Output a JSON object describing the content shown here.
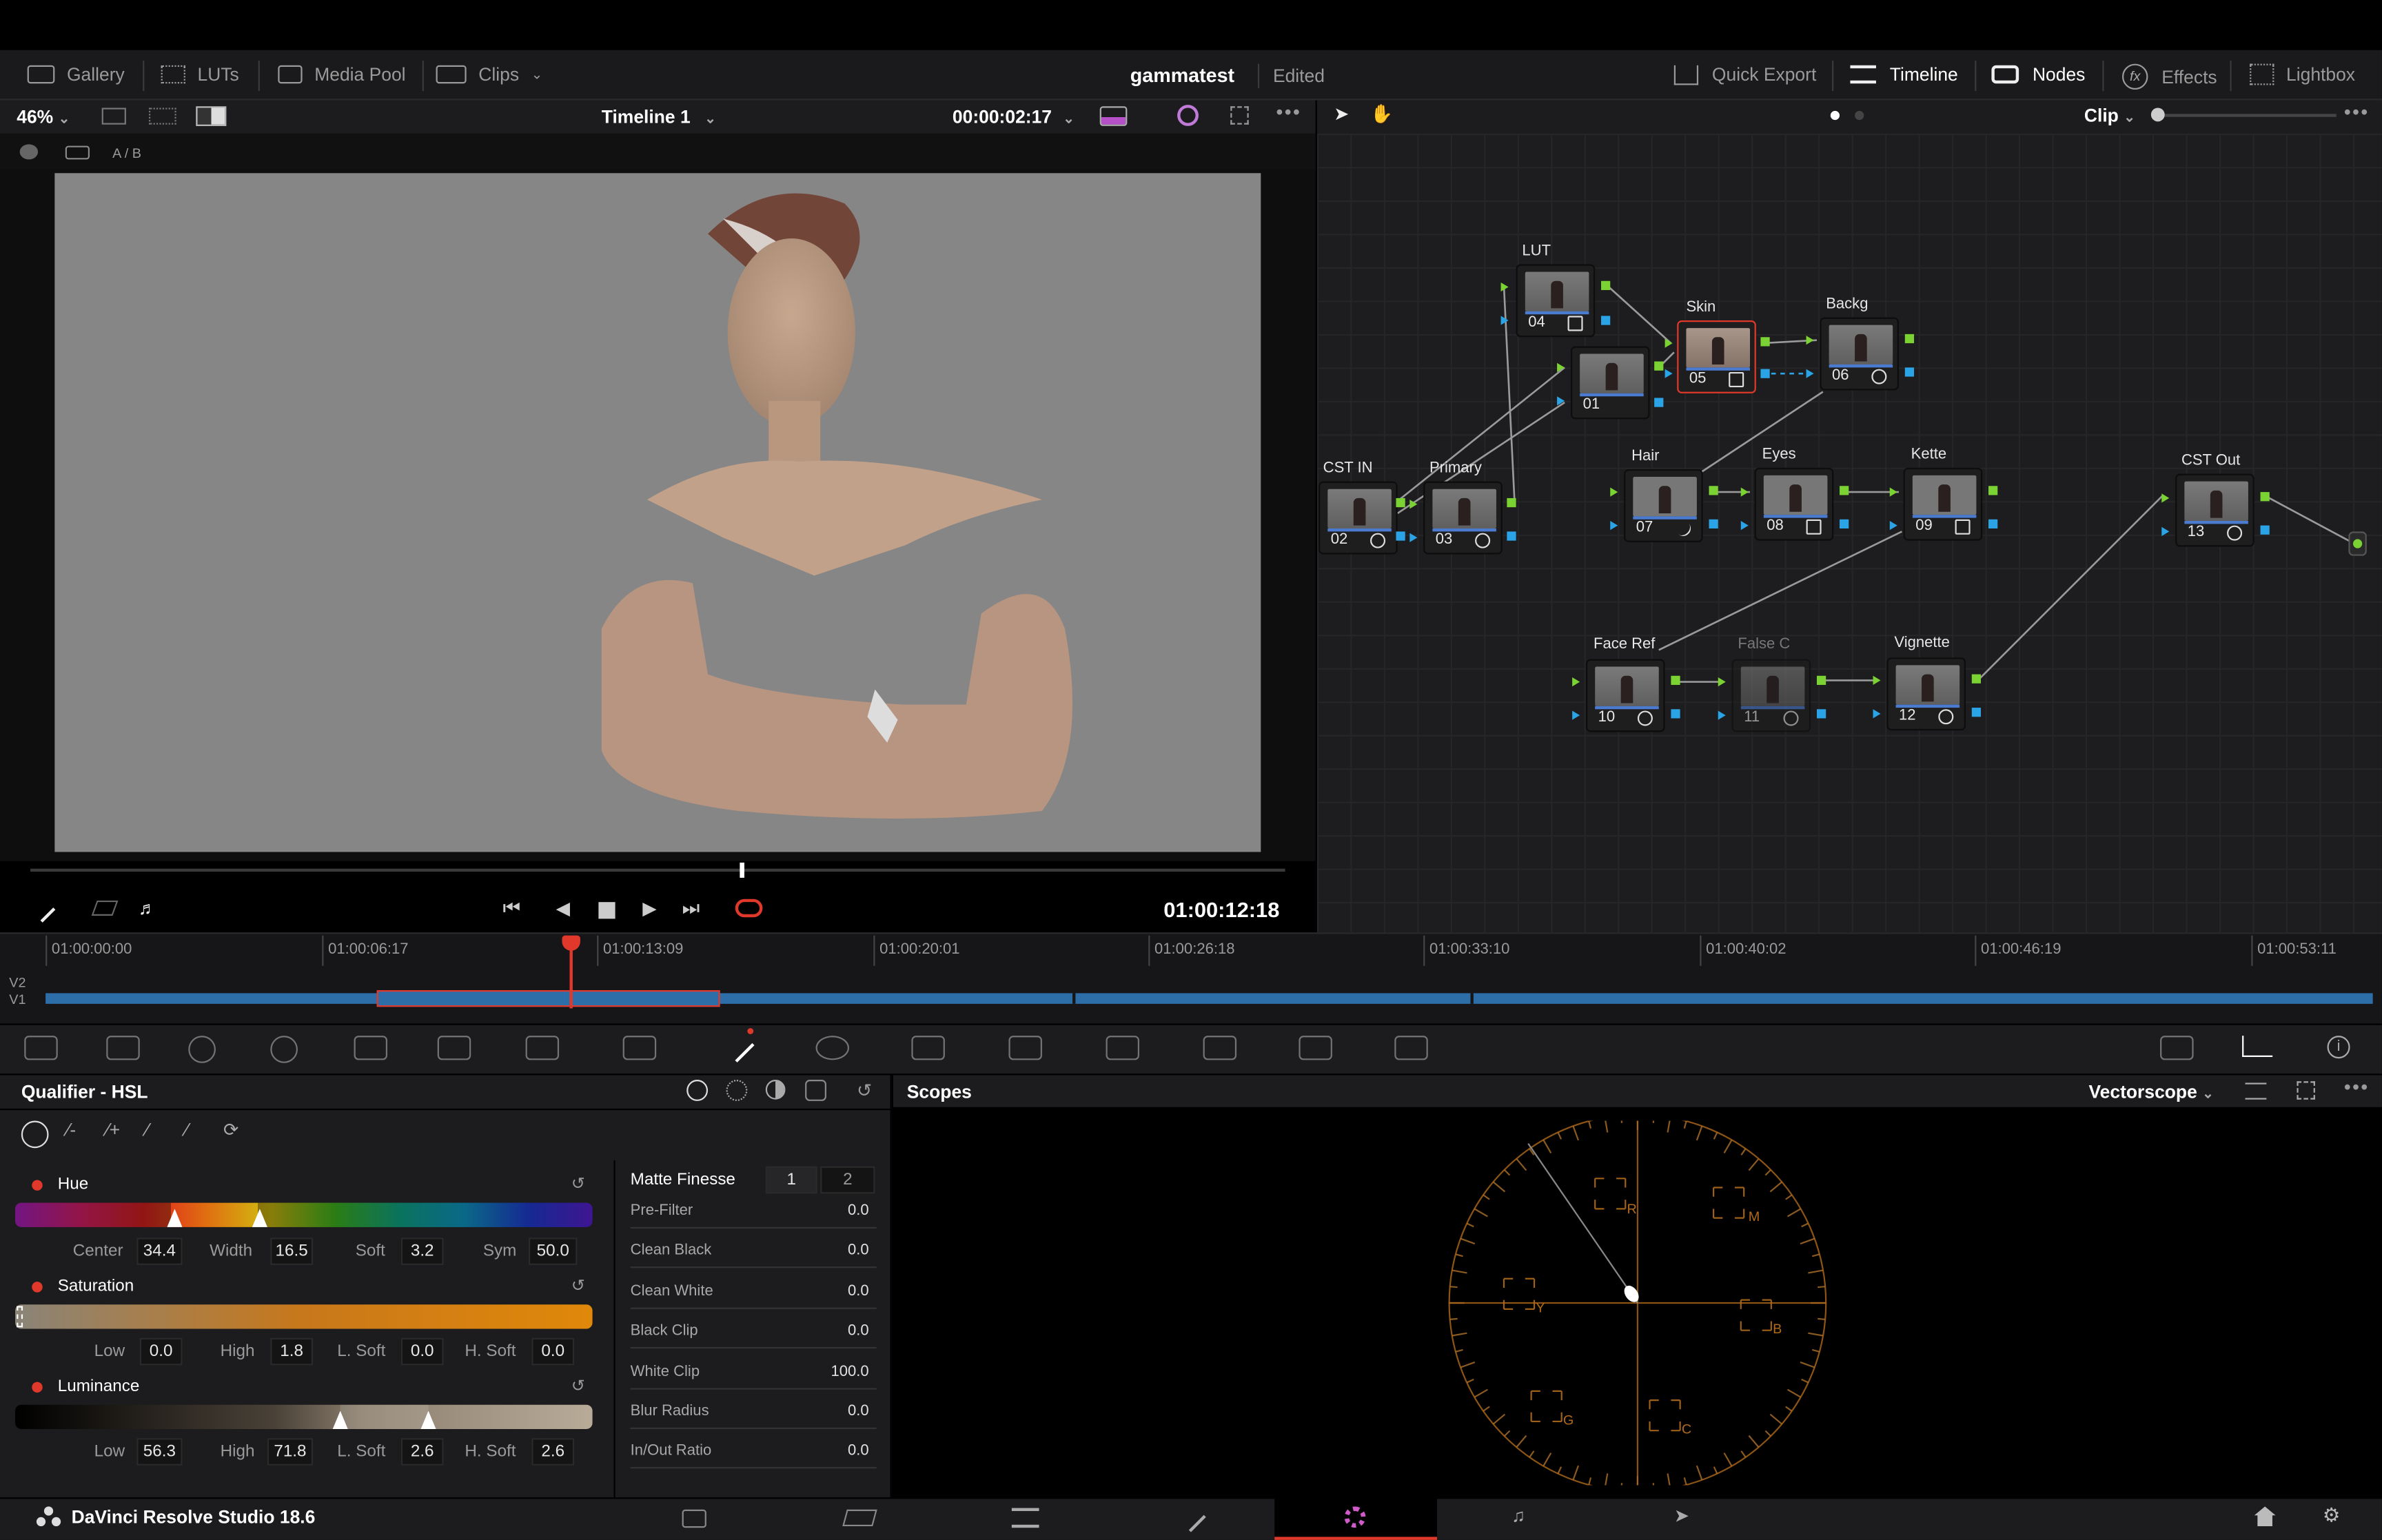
{
  "topbar": {
    "gallery": "Gallery",
    "luts": "LUTs",
    "media_pool": "Media Pool",
    "clips": "Clips",
    "project": "gammatest",
    "status": "Edited",
    "quick_export": "Quick Export",
    "timeline": "Timeline",
    "nodes": "Nodes",
    "effects": "Effects",
    "lightbox": "Lightbox"
  },
  "viewer": {
    "zoom": "46%",
    "timeline_name": "Timeline 1",
    "timecode": "00:00:02:17",
    "ab": "A / B",
    "current_tc": "01:00:12:18"
  },
  "nodes_panel": {
    "mode": "Clip"
  },
  "nodes": [
    {
      "label": "LUT",
      "num": "04"
    },
    {
      "label": "",
      "num": "01"
    },
    {
      "label": "Skin",
      "num": "05"
    },
    {
      "label": "Backg",
      "num": "06"
    },
    {
      "label": "CST IN",
      "num": "02"
    },
    {
      "label": "Primary",
      "num": "03"
    },
    {
      "label": "Hair",
      "num": "07"
    },
    {
      "label": "Eyes",
      "num": "08"
    },
    {
      "label": "Kette",
      "num": "09"
    },
    {
      "label": "CST Out",
      "num": "13"
    },
    {
      "label": "Face Ref",
      "num": "10"
    },
    {
      "label": "False C",
      "num": "11"
    },
    {
      "label": "Vignette",
      "num": "12"
    }
  ],
  "timeline": {
    "track_v2": "V2",
    "track_v1": "V1",
    "ticks": [
      "01:00:00:00",
      "01:00:06:17",
      "01:00:13:09",
      "01:00:20:01",
      "01:00:26:18",
      "01:00:33:10",
      "01:00:40:02",
      "01:00:46:19",
      "01:00:53:11"
    ]
  },
  "qualifier": {
    "title": "Qualifier - HSL",
    "hue": {
      "label": "Hue",
      "center_l": "Center",
      "center": "34.4",
      "width_l": "Width",
      "width": "16.5",
      "soft_l": "Soft",
      "soft": "3.2",
      "sym_l": "Sym",
      "sym": "50.0"
    },
    "saturation": {
      "label": "Saturation",
      "low_l": "Low",
      "low": "0.0",
      "high_l": "High",
      "high": "1.8",
      "lsoft_l": "L. Soft",
      "lsoft": "0.0",
      "hsoft_l": "H. Soft",
      "hsoft": "0.0"
    },
    "luminance": {
      "label": "Luminance",
      "low_l": "Low",
      "low": "56.3",
      "high_l": "High",
      "high": "71.8",
      "lsoft_l": "L. Soft",
      "lsoft": "2.6",
      "hsoft_l": "H. Soft",
      "hsoft": "2.6"
    }
  },
  "matte": {
    "title": "Matte Finesse",
    "tab1": "1",
    "tab2": "2",
    "rows": [
      {
        "label": "Pre-Filter",
        "value": "0.0"
      },
      {
        "label": "Clean Black",
        "value": "0.0"
      },
      {
        "label": "Clean White",
        "value": "0.0"
      },
      {
        "label": "Black Clip",
        "value": "0.0"
      },
      {
        "label": "White Clip",
        "value": "100.0"
      },
      {
        "label": "Blur Radius",
        "value": "0.0"
      },
      {
        "label": "In/Out Ratio",
        "value": "0.0"
      }
    ]
  },
  "scopes": {
    "title": "Scopes",
    "type": "Vectorscope",
    "targets": [
      "R",
      "M",
      "B",
      "C",
      "G",
      "Y"
    ]
  },
  "footer": {
    "app": "DaVinci Resolve Studio 18.6"
  }
}
